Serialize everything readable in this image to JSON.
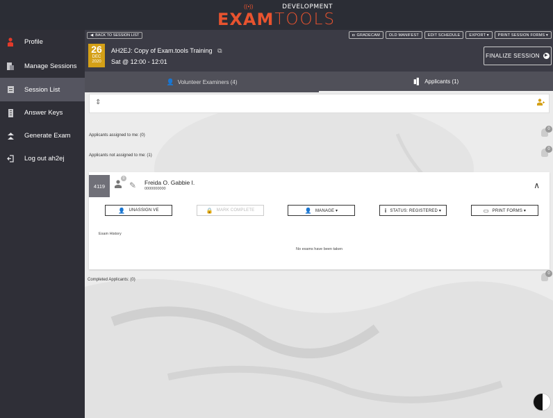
{
  "brand": {
    "development": "DEVELOPMENT",
    "exam": "EXAM",
    "tools": "TOOLS"
  },
  "sidebar": {
    "items": [
      {
        "label": "Profile",
        "icon": "user-icon"
      },
      {
        "label": "Manage Sessions",
        "icon": "clipboard-icon"
      },
      {
        "label": "Session List",
        "icon": "list-icon"
      },
      {
        "label": "Answer Keys",
        "icon": "key-doc-icon"
      },
      {
        "label": "Generate Exam",
        "icon": "generate-icon"
      },
      {
        "label": "Log out ah2ej",
        "icon": "logout-icon"
      }
    ]
  },
  "header": {
    "back_label": "BACK TO SESSION LIST",
    "buttons": {
      "gradecam": "GRADECAM",
      "old_manifest": "OLD MANIFEST",
      "edit_schedule": "EDIT SCHEDULE",
      "export": "EXPORT ▾",
      "print_session_forms": "PRINT SESSION FORMS ▾"
    },
    "date_day": "26",
    "date_month": "DEC",
    "date_year": "2020",
    "session_title": "AH2EJ: Copy of Exam.tools Training",
    "session_time": "Sat @ 12:00 - 12:01",
    "finalize_label": "FINALIZE SESSION"
  },
  "tabs": {
    "volunteers": "Volunteer Examiners (4)",
    "applicants": "Applicants (1)"
  },
  "lists": {
    "assigned_label": "Applicants assigned to me: (0)",
    "assigned_count": "0",
    "not_assigned_label": "Applicants not assigned to me: (1)",
    "not_assigned_count": "0",
    "completed_label": "Completed Applicants: (0)",
    "completed_count": "0"
  },
  "applicant": {
    "id": "4119",
    "avatar_count": "0",
    "name": "Freida O. Gabbie I.",
    "phone": "0000000000",
    "buttons": {
      "unassign": "UNASSIGN VE",
      "mark_complete": "MARK COMPLETE",
      "manage": "MANAGE ▾",
      "status": "STATUS: REGISTERED ▾",
      "print_forms": "PRINT FORMS ▾"
    },
    "exam_history_label": "Exam History",
    "no_exams": "No exams have been taken"
  },
  "colors": {
    "brand_orange": "#e8532f",
    "date_gold": "#d4a017",
    "sidebar_bg": "#2f2f37",
    "header_bg": "#3b3b45"
  }
}
